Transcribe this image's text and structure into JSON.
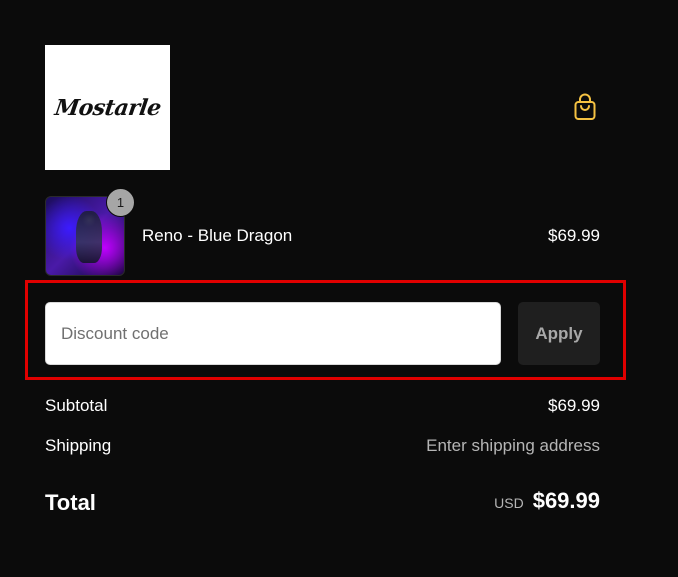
{
  "header": {
    "logo_text": "Mostarle",
    "cart_icon": "shopping-bag-icon",
    "accent_color": "#f5c242"
  },
  "cart": {
    "items": [
      {
        "name": "Reno - Blue Dragon",
        "price": "$69.99",
        "quantity": "1"
      }
    ]
  },
  "discount": {
    "placeholder": "Discount code",
    "value": "",
    "apply_label": "Apply",
    "highlight_color": "#e00000"
  },
  "summary": {
    "subtotal_label": "Subtotal",
    "subtotal_value": "$69.99",
    "shipping_label": "Shipping",
    "shipping_value": "Enter shipping address",
    "total_label": "Total",
    "currency": "USD",
    "total_value": "$69.99"
  }
}
